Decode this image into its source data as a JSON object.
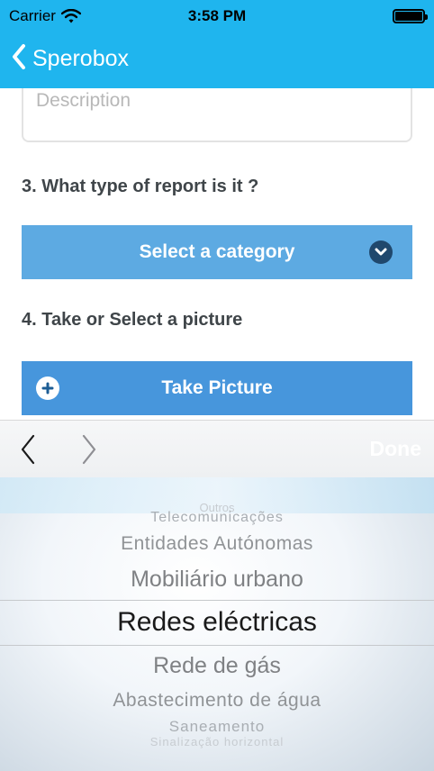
{
  "status_bar": {
    "carrier": "Carrier",
    "time": "3:58 PM",
    "battery_percent": 100
  },
  "nav": {
    "back_label": "Sperobox",
    "back_icon": "chevron-left-icon"
  },
  "form": {
    "description_placeholder": "Description",
    "question3": "3. What type of report is it ?",
    "category_button": "Select a category",
    "question4": "4. Take or Select a picture",
    "take_picture_button": "Take Picture"
  },
  "toolbar": {
    "done_label": "Done"
  },
  "picker": {
    "items": [
      "Outros",
      "Telecomunicações",
      "Entidades Autónomas",
      "Mobiliário urbano",
      "Redes eléctricas",
      "Rede de gás",
      "Abastecimento de água",
      "Saneamento",
      "Sinalização horizontal"
    ],
    "selected": "Redes eléctricas"
  },
  "colors": {
    "nav_blue": "#1fb5ee",
    "category_button": "#5daae2",
    "picture_button": "#4796dc",
    "label_text": "#3f4549"
  }
}
